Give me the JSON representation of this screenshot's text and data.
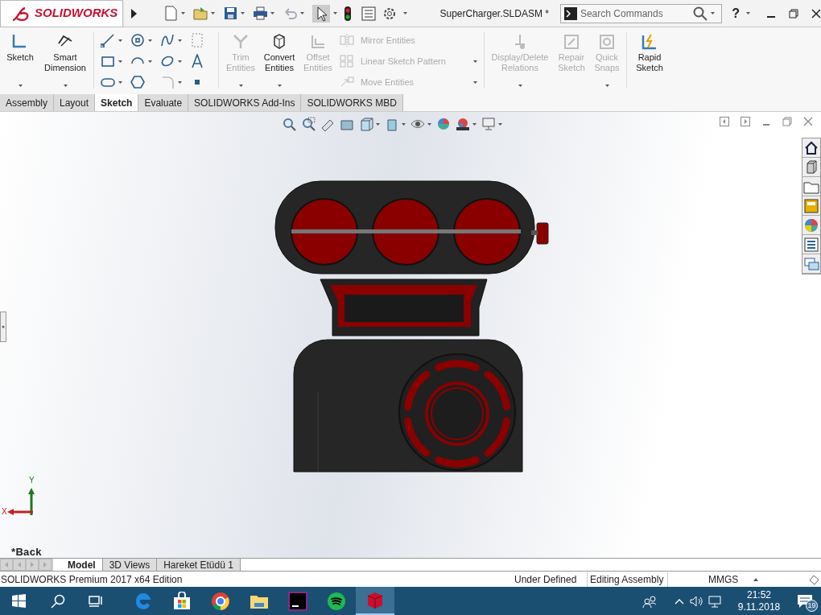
{
  "title_bar": {
    "logo": "SOLIDWORKS",
    "document_title": "SuperCharger.SLDASM *",
    "search": {
      "placeholder": "Search Commands"
    },
    "help": "?"
  },
  "ribbon": {
    "tools": [
      {
        "kind": "large",
        "label": "Sketch",
        "disabled": false,
        "dropdown": true
      },
      {
        "kind": "large",
        "label": "Smart Dimension",
        "disabled": false,
        "dropdown": true
      },
      {
        "kind": "sketch_grid"
      },
      {
        "kind": "large",
        "label": "Trim Entities",
        "disabled": true,
        "dropdown": true
      },
      {
        "kind": "large",
        "label": "Convert Entities",
        "disabled": false,
        "dropdown": true
      },
      {
        "kind": "large",
        "label": "Offset Entities",
        "disabled": true,
        "dropdown": false
      },
      {
        "kind": "rows",
        "items": [
          {
            "label": "Mirror Entities",
            "disabled": true,
            "dropdown": false
          },
          {
            "label": "Linear Sketch Pattern",
            "disabled": true,
            "dropdown": true
          },
          {
            "label": "Move Entities",
            "disabled": true,
            "dropdown": true
          }
        ]
      },
      {
        "kind": "large",
        "label": "Display/Delete Relations",
        "disabled": true,
        "dropdown": true
      },
      {
        "kind": "large",
        "label": "Repair Sketch",
        "disabled": true,
        "dropdown": false
      },
      {
        "kind": "large",
        "label": "Quick Snaps",
        "disabled": true,
        "dropdown": true
      },
      {
        "kind": "large",
        "label": "Rapid Sketch",
        "disabled": false,
        "dropdown": false
      }
    ]
  },
  "command_tabs": [
    {
      "label": "Assembly",
      "selected": false
    },
    {
      "label": "Layout",
      "selected": false
    },
    {
      "label": "Sketch",
      "selected": true
    },
    {
      "label": "Evaluate",
      "selected": false
    },
    {
      "label": "SOLIDWORKS Add-Ins",
      "selected": false
    },
    {
      "label": "SOLIDWORKS MBD",
      "selected": false
    }
  ],
  "viewport": {
    "triad": {
      "x": "X",
      "y": "Y"
    },
    "view_name": "*Back"
  },
  "model_tabs": [
    {
      "label": "Model",
      "selected": true
    },
    {
      "label": "3D Views",
      "selected": false
    },
    {
      "label": "Hareket Etüdü 1",
      "selected": false
    }
  ],
  "status_bar": {
    "edition": "SOLIDWORKS Premium 2017 x64 Edition",
    "fields": [
      "Under Defined",
      "Editing Assembly",
      "MMGS"
    ]
  },
  "taskbar": {
    "apps": [
      {
        "kind": "edge",
        "active": false
      },
      {
        "kind": "store",
        "active": false
      },
      {
        "kind": "chrome",
        "active": false
      },
      {
        "kind": "explorer",
        "active": false
      },
      {
        "kind": "intellij",
        "active": false
      },
      {
        "kind": "spotify",
        "active": false
      },
      {
        "kind": "solidworks",
        "active": true
      }
    ],
    "time": "21:52",
    "date": "9.11.2018",
    "notifications": "19"
  }
}
